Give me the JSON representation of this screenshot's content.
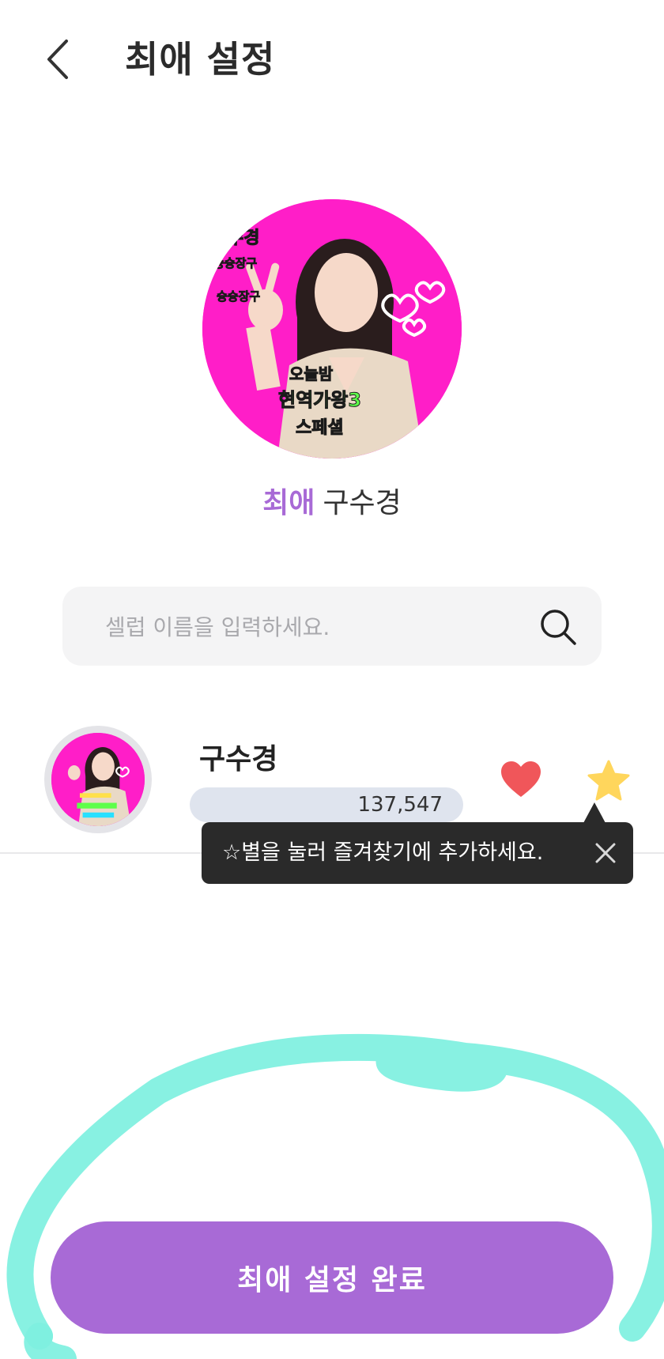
{
  "header": {
    "title": "최애 설정",
    "back_icon": "chevron-left-icon"
  },
  "profile": {
    "choi_tag": "최애",
    "name": "구수경",
    "photo_texts": [
      "수경",
      "슝슝장구",
      "슝슝장구",
      "오늘밤",
      "현역가왕3",
      "스페셜"
    ],
    "photo_bg_color": "#ff1ec8"
  },
  "search": {
    "placeholder": "셀럽 이름을 입력하세요.",
    "value": "",
    "icon": "search-icon"
  },
  "list": {
    "items": [
      {
        "name": "구수경",
        "count": "137,547",
        "heart_icon": "heart-icon",
        "star_icon": "star-icon"
      }
    ]
  },
  "tooltip": {
    "text": "☆별을 눌러 즐겨찾기에 추가하세요.",
    "close_icon": "close-icon"
  },
  "footer": {
    "confirm_label": "최애 설정 완료"
  },
  "colors": {
    "accent": "#a86ad6",
    "heart": "#f0565a",
    "star": "#ffd65c",
    "tooltip_bg": "#2a2a2a",
    "scribble": "#7ef0e0"
  }
}
